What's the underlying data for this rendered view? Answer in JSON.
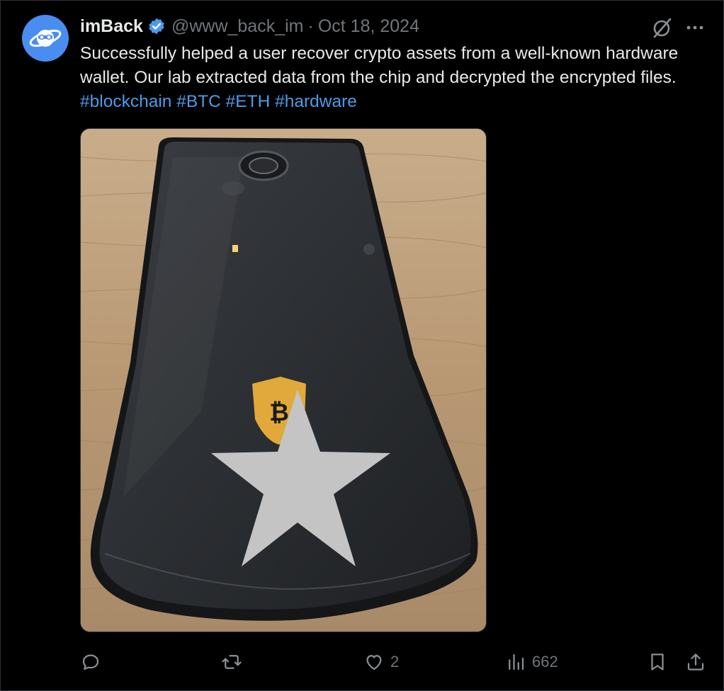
{
  "tweet": {
    "author": {
      "display_name": "imBack",
      "handle": "@www_back_im",
      "verified": true
    },
    "separator": "·",
    "date": "Oct 18, 2024",
    "text_parts": [
      "Successfully helped a user recover crypto assets from a well-known hardware wallet. Our lab extracted data from the chip and decrypted the encrypted files. ",
      "#blockchain",
      " ",
      "#BTC",
      " ",
      "#ETH",
      " ",
      "#hardware"
    ],
    "media": {
      "icon": "bitcoin-shield-logo",
      "overlay_icon": "star-icon"
    },
    "actions": {
      "reply_count": "",
      "retweet_count": "",
      "like_count": "2",
      "views_count": "662"
    }
  },
  "colors": {
    "background": "#000000",
    "text": "#e7e9ea",
    "muted": "#71767b",
    "link": "#4c9be8",
    "verified": "#4c9be8",
    "avatar": "#4a8df0"
  }
}
